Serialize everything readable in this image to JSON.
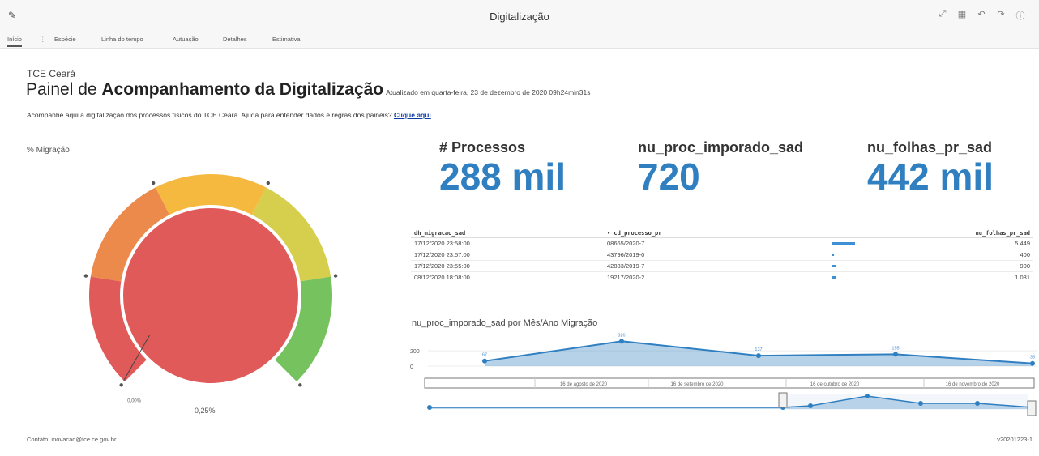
{
  "app": {
    "title": "Digitalização",
    "pen_icon": "pencil-icon"
  },
  "toolbar_icons": [
    "expand-icon",
    "table-icon",
    "undo-icon",
    "redo-icon",
    "info-icon"
  ],
  "tabs": [
    {
      "label": "Início",
      "active": true
    },
    {
      "label": "Espécie"
    },
    {
      "label": "Linha do tempo"
    },
    {
      "label": "Autuação"
    },
    {
      "label": "Detalhes"
    },
    {
      "label": "Estimativa"
    }
  ],
  "tabs_more": "⋮",
  "header": {
    "org": "TCE Ceará",
    "title_prefix": "Painel de ",
    "title_bold": "Acompanhamento da Digitalização",
    "updated": "Atualizado em quarta-feira, 23 de dezembro de 2020 09h24min31s",
    "intro": "Acompanhe aqui a digitalização dos processos físicos do TCE Ceará. Ajuda para entender dados e regras dos painéis? ",
    "intro_link": "Clique aqui"
  },
  "gauge": {
    "title": "% Migração",
    "value_label": "0,25%",
    "min_label": "0,00%",
    "value_fraction": 0.0025,
    "colors": [
      "#e05a5a",
      "#ec8a4c",
      "#f6b93f",
      "#d6cf4e",
      "#76c25e"
    ],
    "fill_color": "#e05a5a"
  },
  "kpis": [
    {
      "label": "# Processos",
      "value": "288 mil"
    },
    {
      "label": "nu_proc_imporado_sad",
      "value": "720"
    },
    {
      "label": "nu_folhas_pr_sad",
      "value": "442 mil"
    }
  ],
  "table": {
    "headers": [
      "dh_migracao_sad",
      "▾ cd_processo_pr",
      "nu_folhas_pr_sad"
    ],
    "rows": [
      {
        "date": "17/12/2020 23:58:00",
        "proc": "08665/2020-7",
        "folhas": "5.449",
        "bar": 5449
      },
      {
        "date": "17/12/2020 23:57:00",
        "proc": "43796/2019-0",
        "folhas": "400",
        "bar": 400
      },
      {
        "date": "17/12/2020 23:55:00",
        "proc": "42833/2019-7",
        "folhas": "900",
        "bar": 900
      },
      {
        "date": "08/12/2020 18:08:00",
        "proc": "19217/2020-2",
        "folhas": "1.031",
        "bar": 1031
      }
    ]
  },
  "chart_data": {
    "type": "area",
    "title": "nu_proc_imporado_sad por Mês/Ano Migração",
    "ytick_labels": [
      "200",
      "0"
    ],
    "ylim": [
      0,
      340
    ],
    "points": [
      {
        "x": "jul 2020",
        "y": 67,
        "label": "67"
      },
      {
        "x": "ago 2020",
        "y": 326,
        "label": "326"
      },
      {
        "x": "set 2020",
        "y": 137,
        "label": "137"
      },
      {
        "x": "out 2020",
        "y": 155,
        "label": "155"
      },
      {
        "x": "nov 2020",
        "y": 35,
        "label": "35"
      }
    ],
    "navigator_labels": [
      "16 de agosto de 2020",
      "16 de setembro de 2020",
      "16 de outubro de 2020",
      "16 de novembro de 2020"
    ],
    "color": "#2f7fc1"
  },
  "footer": {
    "contact": "Contato: inovacao@tce.ce.gov.br",
    "version": "v20201223-1"
  }
}
